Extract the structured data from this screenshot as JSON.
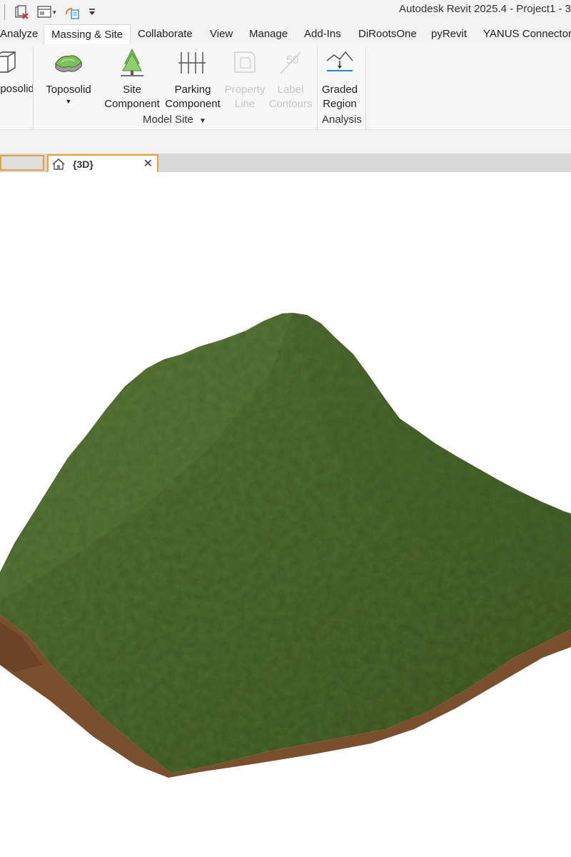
{
  "app": {
    "title": "Autodesk Revit 2025.4 - Project1 - 3"
  },
  "quick_access": {
    "icons": [
      "close-views-icon",
      "switch-windows-icon",
      "sync-icon",
      "customize-caret-icon"
    ]
  },
  "tabs": [
    {
      "label": "Analyze",
      "active": false
    },
    {
      "label": "Massing & Site",
      "active": true
    },
    {
      "label": "Collaborate",
      "active": false
    },
    {
      "label": "View",
      "active": false
    },
    {
      "label": "Manage",
      "active": false
    },
    {
      "label": "Add-Ins",
      "active": false
    },
    {
      "label": "DiRootsOne",
      "active": false
    },
    {
      "label": "pyRevit",
      "active": false
    },
    {
      "label": "YANUS Connector",
      "active": false
    }
  ],
  "ribbon": {
    "partial_button": {
      "label": "oposolid"
    },
    "model_site": {
      "panel_label": "Model Site",
      "buttons": [
        {
          "line1": "Toposolid",
          "line2": "",
          "has_dropdown": true,
          "enabled": true
        },
        {
          "line1": "Site",
          "line2": "Component",
          "enabled": true
        },
        {
          "line1": "Parking",
          "line2": "Component",
          "enabled": true
        },
        {
          "line1": "Property",
          "line2": "Line",
          "enabled": false
        },
        {
          "line1": "Label",
          "line2": "Contours",
          "enabled": false
        }
      ]
    },
    "analysis": {
      "panel_label": "Analysis",
      "buttons": [
        {
          "line1": "Graded",
          "line2": "Region",
          "enabled": true
        }
      ]
    }
  },
  "view_tabs": {
    "active_label": "{3D}"
  },
  "colors": {
    "terrain_top": "#4d6a30",
    "terrain_top_light": "#587638",
    "terrain_soil": "#7a4f2e",
    "active_tab_border": "#f0a030",
    "accent_blue": "#1e88e5"
  }
}
